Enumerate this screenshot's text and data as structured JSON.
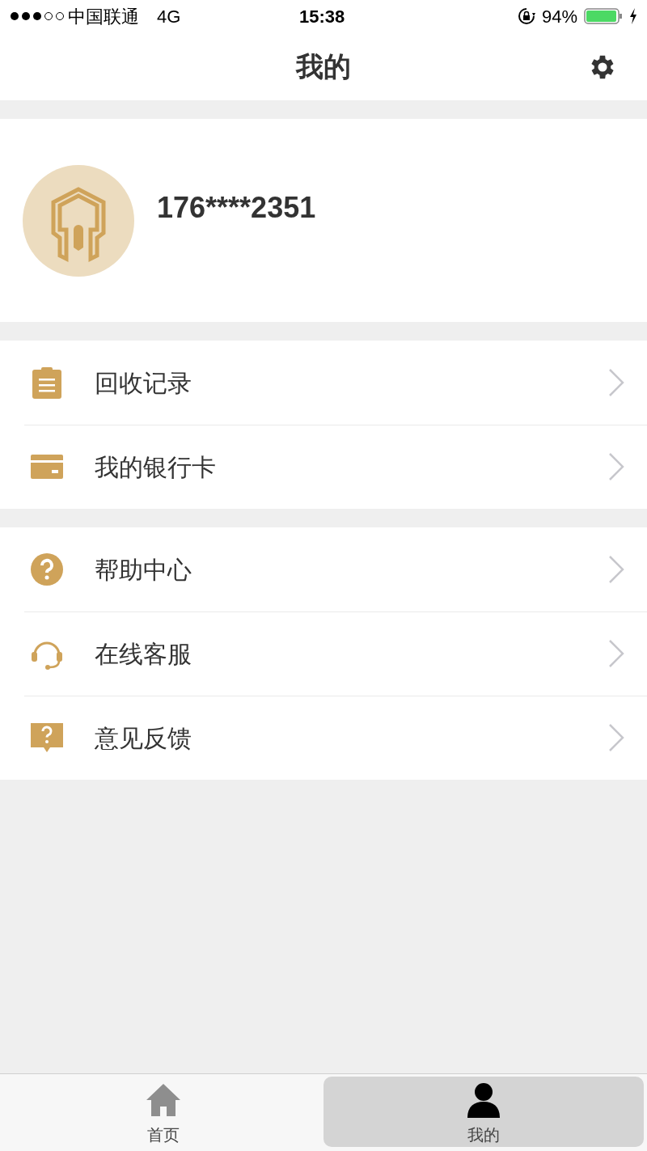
{
  "status_bar": {
    "carrier": "中国联通",
    "network": "4G",
    "time": "15:38",
    "battery": "94%"
  },
  "nav": {
    "title": "我的"
  },
  "profile": {
    "phone": "176****2351"
  },
  "menu_groups": [
    {
      "items": [
        {
          "label": "回收记录"
        },
        {
          "label": "我的银行卡"
        }
      ]
    },
    {
      "items": [
        {
          "label": "帮助中心"
        },
        {
          "label": "在线客服"
        },
        {
          "label": "意见反馈"
        }
      ]
    }
  ],
  "tabs": [
    {
      "label": "首页",
      "selected": false
    },
    {
      "label": "我的",
      "selected": true
    }
  ]
}
